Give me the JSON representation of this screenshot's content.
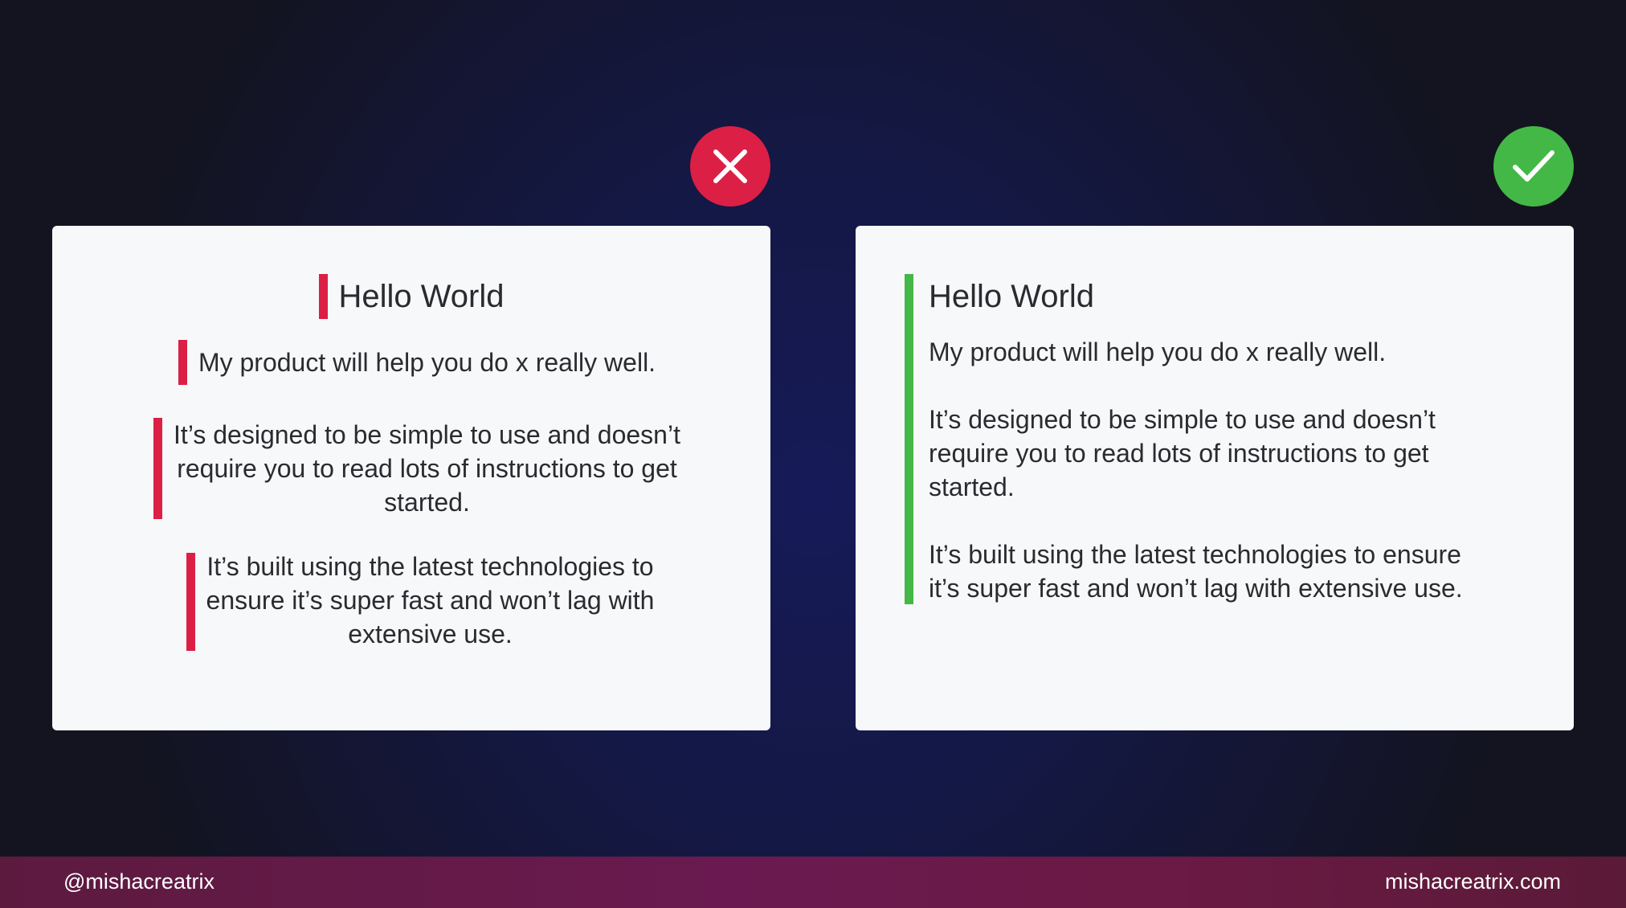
{
  "colors": {
    "bad": "#dc1f45",
    "good": "#44b846",
    "card_background": "#f7f8fa",
    "text": "#2b2b2f"
  },
  "bad_example": {
    "icon": "x-mark-icon",
    "title": "Hello World",
    "paragraph1": "My product will help you do x really well.",
    "paragraph2_lines": [
      "It’s designed to be simple to use and doesn’t",
      "require you to read lots of instructions to get",
      "started."
    ],
    "paragraph3_lines": [
      "It’s built using the latest technologies to",
      "ensure it’s super fast and won’t lag with",
      "extensive use."
    ]
  },
  "good_example": {
    "icon": "checkmark-icon",
    "title": "Hello World",
    "paragraph1": "My product will help you do x really well.",
    "paragraph2_lines": [
      "It’s designed to be simple to use and doesn’t",
      "require you to read lots of instructions to get",
      "started."
    ],
    "paragraph3_lines": [
      "It’s built using the latest technologies to ensure",
      "it’s super fast and won’t lag with extensive use."
    ]
  },
  "footer": {
    "handle": "@mishacreatrix",
    "website": "mishacreatrix.com"
  }
}
